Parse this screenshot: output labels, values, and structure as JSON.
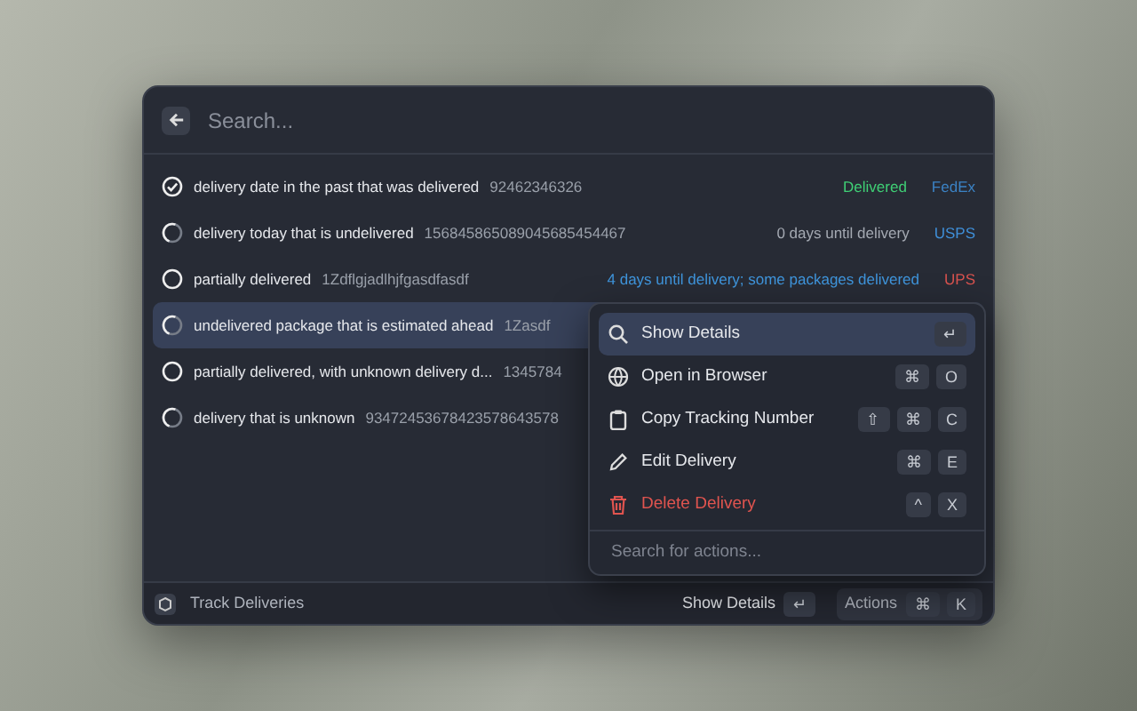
{
  "search": {
    "placeholder": "Search..."
  },
  "deliveries": [
    {
      "kind": "delivered",
      "name": "delivery date in the past that was delivered",
      "tracking": "92462346326",
      "eta": {
        "text": "Delivered",
        "color": "#3fcf75"
      },
      "carrier": "FedEx",
      "color": "#3b82c4",
      "selected": false
    },
    {
      "kind": "pending",
      "name": "delivery today that is undelivered",
      "tracking": "156845865089045685454467",
      "eta": {
        "text": "0 days until delivery",
        "color": "#a4a9b2"
      },
      "carrier": "USPS",
      "color": "#3f8fd8",
      "selected": false
    },
    {
      "kind": "partial",
      "name": "partially delivered",
      "tracking": "1Zdflgjadlhjfgasdfasdf",
      "eta": {
        "text": "4 days until delivery; some packages delivered",
        "color": "#3f95dc"
      },
      "carrier": "UPS",
      "color": "#d9534f",
      "selected": false
    },
    {
      "kind": "pending",
      "name": "undelivered package that is estimated ahead",
      "tracking": "1Zasdf",
      "selected": true
    },
    {
      "kind": "partial",
      "name": "partially delivered, with unknown delivery d...",
      "tracking": "1345784",
      "selected": false
    },
    {
      "kind": "pending",
      "name": "delivery that is unknown",
      "tracking": "93472453678423578643578",
      "selected": false
    }
  ],
  "actions": {
    "items": [
      {
        "kind": "search",
        "label": "Show Details",
        "keys": [
          "↵"
        ],
        "selected": true,
        "danger": false
      },
      {
        "kind": "globe",
        "label": "Open in Browser",
        "keys": [
          "⌘",
          "O"
        ],
        "selected": false,
        "danger": false
      },
      {
        "kind": "clipboard",
        "label": "Copy Tracking Number",
        "keys": [
          "⇧",
          "⌘",
          "C"
        ],
        "selected": false,
        "danger": false
      },
      {
        "kind": "pencil",
        "label": "Edit Delivery",
        "keys": [
          "⌘",
          "E"
        ],
        "selected": false,
        "danger": false
      },
      {
        "kind": "trash",
        "label": "Delete Delivery",
        "keys": [
          "^",
          "X"
        ],
        "selected": false,
        "danger": true
      }
    ],
    "search_placeholder": "Search for actions..."
  },
  "footer": {
    "title": "Track Deliveries",
    "primary": {
      "label": "Show Details",
      "keys": [
        "↵"
      ]
    },
    "secondary": {
      "label": "Actions",
      "keys": [
        "⌘",
        "K"
      ]
    }
  }
}
